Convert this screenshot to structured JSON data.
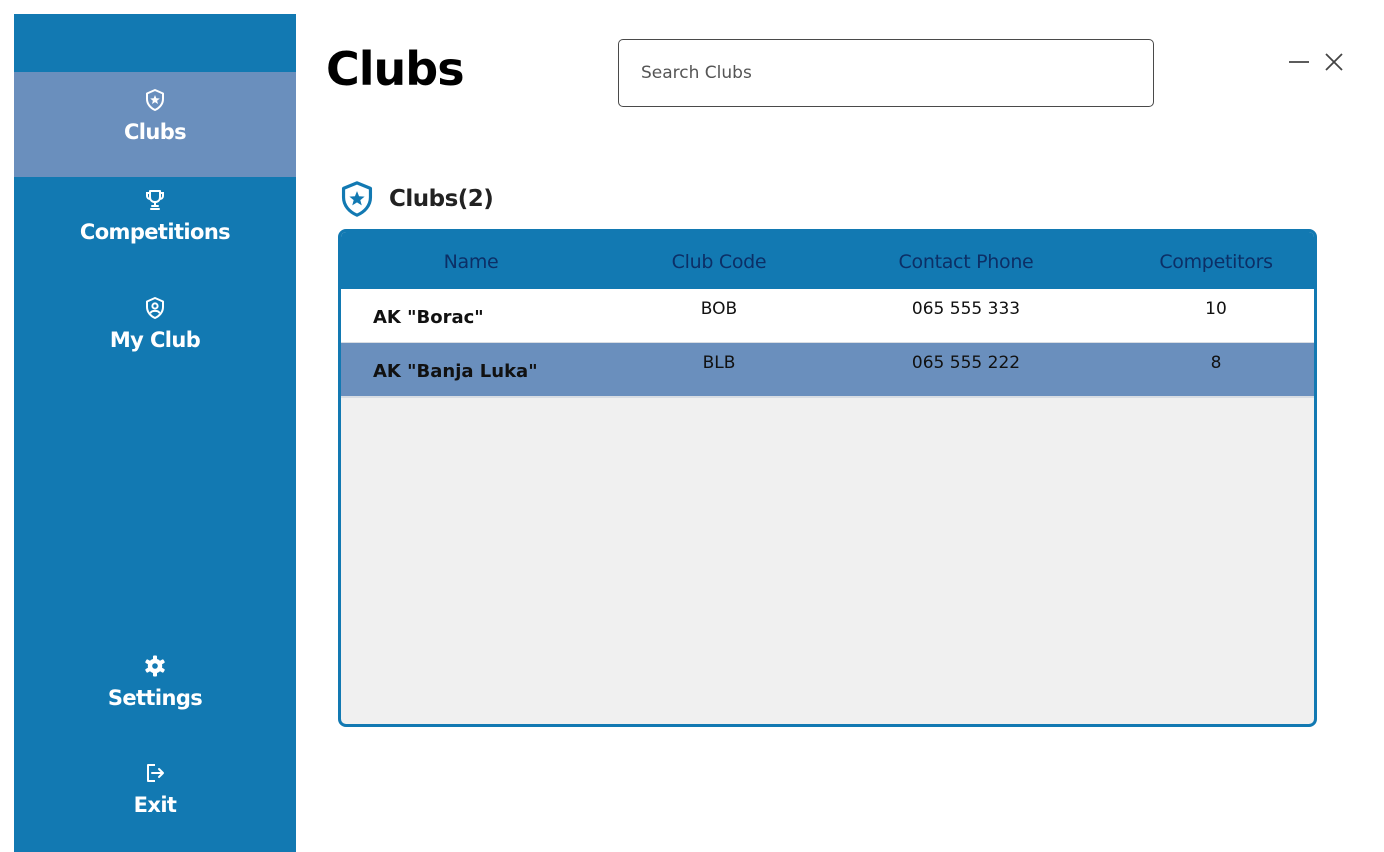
{
  "sidebar": {
    "items": [
      {
        "id": "clubs",
        "label": "Clubs",
        "icon": "shield-star-icon",
        "active": true
      },
      {
        "id": "competitions",
        "label": "Competitions",
        "icon": "trophy-icon",
        "active": false
      },
      {
        "id": "my_club",
        "label": "My Club",
        "icon": "user-shield-icon",
        "active": false
      },
      {
        "id": "settings",
        "label": "Settings",
        "icon": "gear-icon",
        "active": false
      },
      {
        "id": "exit",
        "label": "Exit",
        "icon": "exit-icon",
        "active": false
      }
    ]
  },
  "header": {
    "title": "Clubs",
    "search": {
      "placeholder": "Search Clubs",
      "value": ""
    }
  },
  "window_controls": {
    "minimize": "minimize-icon",
    "close": "close-icon"
  },
  "section": {
    "title": "Clubs(2)",
    "icon": "shield-star-icon"
  },
  "table": {
    "columns": [
      "Name",
      "Club Code",
      "Contact Phone",
      "Competitors"
    ],
    "rows": [
      {
        "name": "AK \"Borac\"",
        "code": "BOB",
        "phone": "065 555 333",
        "competitors": "10",
        "selected": false
      },
      {
        "name": "AK \"Banja Luka\"",
        "code": "BLB",
        "phone": "065 555 222",
        "competitors": "8",
        "selected": true
      }
    ]
  },
  "colors": {
    "sidebar": "#1279b2",
    "active_item": "#6a8fbd",
    "header_text": "#0c2f66",
    "selected_row": "#6a8fbd",
    "table_body": "#f0f0f0"
  }
}
